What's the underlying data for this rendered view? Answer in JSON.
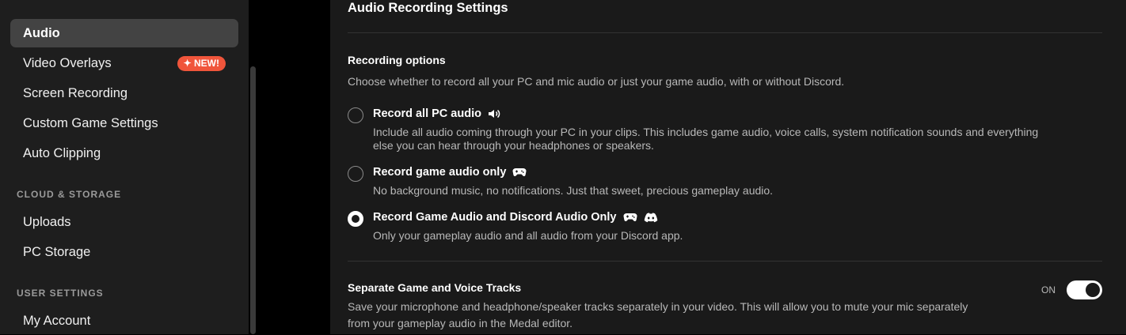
{
  "sidebar": {
    "items": [
      {
        "label": "Audio"
      },
      {
        "label": "Video Overlays",
        "badge": "NEW!"
      },
      {
        "label": "Screen Recording"
      },
      {
        "label": "Custom Game Settings"
      },
      {
        "label": "Auto Clipping"
      }
    ],
    "cloud_heading": "CLOUD & STORAGE",
    "cloud_items": [
      {
        "label": "Uploads"
      },
      {
        "label": "PC Storage"
      }
    ],
    "user_heading": "USER SETTINGS",
    "user_items": [
      {
        "label": "My Account"
      }
    ]
  },
  "main": {
    "title": "Audio Recording Settings",
    "recording": {
      "heading": "Recording options",
      "description": "Choose whether to record all your PC and mic audio or just your game audio, with or without Discord.",
      "options": [
        {
          "title": "Record all PC audio",
          "icons": [
            "speaker-icon"
          ],
          "description_lines": [
            "Include all audio coming through your PC in your clips. This includes game audio, voice calls, system notification sounds and everything",
            "else you can hear through your headphones or speakers."
          ],
          "checked": false
        },
        {
          "title": "Record game audio only",
          "icons": [
            "gamepad-icon"
          ],
          "description_lines": [
            "No background music, no notifications. Just that sweet, precious gameplay audio."
          ],
          "checked": false
        },
        {
          "title": "Record Game Audio and Discord Audio Only",
          "icons": [
            "gamepad-icon",
            "discord-icon"
          ],
          "description_lines": [
            "Only your gameplay audio and all audio from your Discord app."
          ],
          "checked": true
        }
      ]
    },
    "separate_tracks": {
      "heading": "Separate Game and Voice Tracks",
      "description_lines": [
        "Save your microphone and headphone/speaker tracks separately in your video. This will allow you to mute your mic separately",
        "from your gameplay audio in the Medal editor."
      ],
      "toggle_label": "ON",
      "enabled": true
    }
  },
  "colors": {
    "accent_badge": "#f0553b",
    "sidebar_bg": "#1e1e1e",
    "panel_bg": "#1a1a1a",
    "active_item_bg": "#434343"
  }
}
